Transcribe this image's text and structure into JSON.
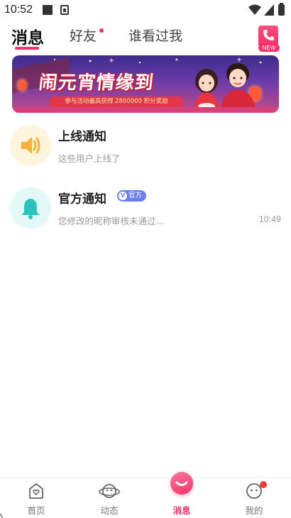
{
  "status_bar": {
    "time": "10:52",
    "icons": [
      "notification-square-icon",
      "sim-card-icon",
      "wifi-icon",
      "signal-icon",
      "battery-icon"
    ]
  },
  "tabs": {
    "messages": "消息",
    "friends": "好友",
    "visitors": "谁看过我",
    "call_badge": "NEW"
  },
  "banner": {
    "title": "闹元宵情缘到",
    "subtitle": "参与活动最高获得 2800000 积分奖励"
  },
  "notifications": [
    {
      "title": "上线通知",
      "subtitle": "这些用户上线了",
      "time": "",
      "icon": "speaker-icon"
    },
    {
      "title": "官方通知",
      "badge": "官方",
      "badge_mark": "V",
      "subtitle": "您修改的昵称审核未通过...",
      "time": "10:49",
      "icon": "bell-icon"
    }
  ],
  "bottom_nav": {
    "home": "首页",
    "feed": "动态",
    "messages": "消息",
    "me": "我的"
  },
  "colors": {
    "accent": "#f4306b",
    "official_badge": "#6a7df2",
    "speaker": "#f7b23b",
    "bell": "#2cc3bf"
  }
}
